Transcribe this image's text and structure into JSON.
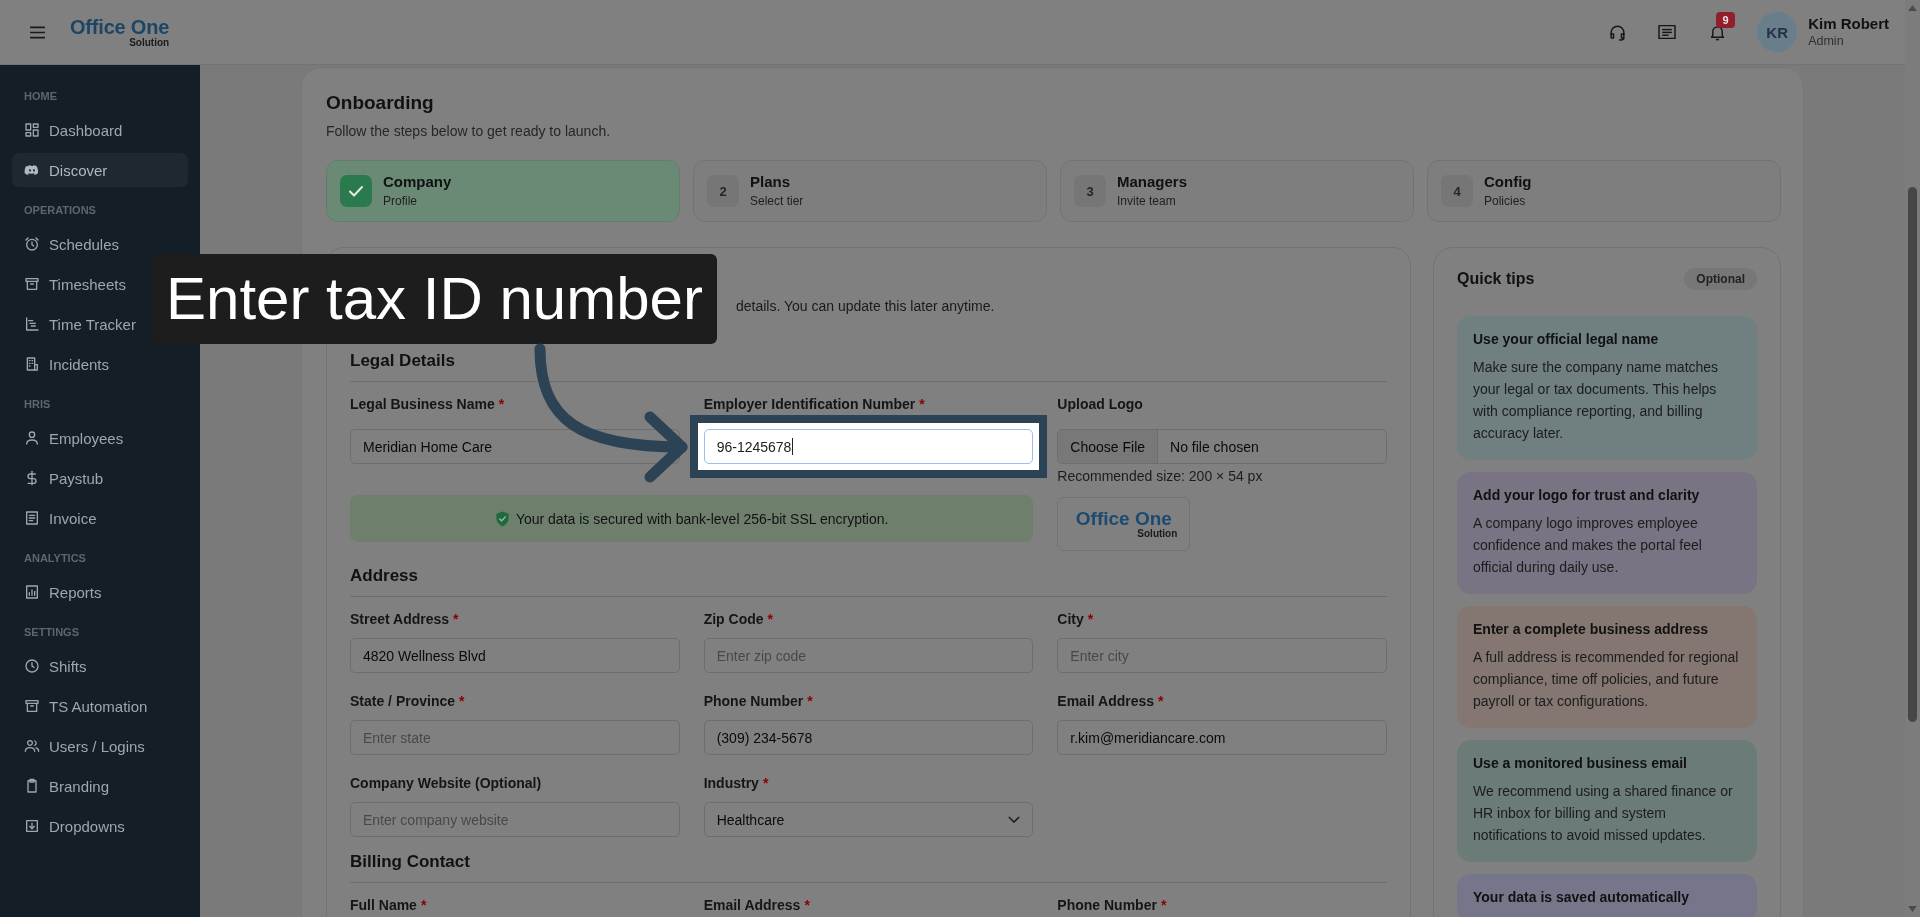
{
  "header": {
    "logo": {
      "name": "Office One",
      "tagline": "Solution"
    },
    "notification_count": "9",
    "user": {
      "initials": "KR",
      "name": "Kim Robert",
      "role": "Admin"
    }
  },
  "sidebar": {
    "sections": [
      {
        "heading": "HOME",
        "items": [
          {
            "label": "Dashboard",
            "selected": false
          },
          {
            "label": "Discover",
            "selected": true
          }
        ]
      },
      {
        "heading": "OPERATIONS",
        "items": [
          {
            "label": "Schedules",
            "selected": false
          },
          {
            "label": "Timesheets",
            "selected": false
          },
          {
            "label": "Time Tracker",
            "selected": false
          },
          {
            "label": "Incidents",
            "selected": false
          }
        ]
      },
      {
        "heading": "HRIS",
        "items": [
          {
            "label": "Employees",
            "selected": false
          },
          {
            "label": "Paystub",
            "selected": false
          },
          {
            "label": "Invoice",
            "selected": false
          }
        ]
      },
      {
        "heading": "ANALYTICS",
        "items": [
          {
            "label": "Reports",
            "selected": false
          }
        ]
      },
      {
        "heading": "SETTINGS",
        "items": [
          {
            "label": "Shifts",
            "selected": false
          },
          {
            "label": "TS Automation",
            "selected": false
          },
          {
            "label": "Users / Logins",
            "selected": false
          },
          {
            "label": "Branding",
            "selected": false
          },
          {
            "label": "Dropdowns",
            "selected": false
          }
        ]
      }
    ]
  },
  "onboarding": {
    "title": "Onboarding",
    "subtitle": "Follow the steps below to get ready to launch.",
    "steps": [
      {
        "title": "Company",
        "subtitle": "Profile",
        "completed": true
      },
      {
        "number": "2",
        "title": "Plans",
        "subtitle": "Select tier",
        "completed": false
      },
      {
        "number": "3",
        "title": "Managers",
        "subtitle": "Invite team",
        "completed": false
      },
      {
        "number": "4",
        "title": "Config",
        "subtitle": "Policies",
        "completed": false
      }
    ]
  },
  "form": {
    "intro": "details. You can update this later anytime.",
    "sections": [
      {
        "title": "Legal Details",
        "fields": [
          {
            "label": "Legal Business Name",
            "mark": "*",
            "kind": "text",
            "value": "Meridian Home Care"
          },
          {
            "label": "Employer Identification Number",
            "mark": "*",
            "kind": "text",
            "value": "96-1245678",
            "spotlight": true,
            "focused": true
          },
          {
            "label": "Upload Logo",
            "kind": "file",
            "button": "Choose File",
            "status": "No file chosen",
            "hint": "Recommended size: 200 × 54 px",
            "preview": {
              "name": "Office One",
              "tagline": "Solution"
            }
          }
        ],
        "notice": "Your data is secured with bank-level 256-bit SSL encryption."
      },
      {
        "title": "Address",
        "fields": [
          {
            "label": "Street Address",
            "mark": "*",
            "kind": "text",
            "value": "4820 Wellness Blvd"
          },
          {
            "label": "Zip Code",
            "mark": "*",
            "kind": "text",
            "placeholder": "Enter zip code"
          },
          {
            "label": "City",
            "mark": "*",
            "kind": "text",
            "placeholder": "Enter city"
          },
          {
            "label": "State / Province",
            "mark": "*",
            "kind": "text",
            "placeholder": "Enter state"
          },
          {
            "label": "Phone Number",
            "mark": "*",
            "kind": "text",
            "value": "(309) 234-5678"
          },
          {
            "label": "Email Address",
            "mark": "*",
            "kind": "text",
            "value": "r.kim@meridiancare.com"
          },
          {
            "label": "Company Website (Optional)",
            "kind": "text",
            "placeholder": "Enter company website"
          },
          {
            "label": "Industry",
            "mark": "*",
            "kind": "select",
            "value": "Healthcare"
          }
        ]
      },
      {
        "title": "Billing Contact",
        "fields": [
          {
            "label": "Full Name",
            "mark": "*"
          },
          {
            "label": "Email Address",
            "mark": "*"
          },
          {
            "label": "Phone Number",
            "mark": "*"
          }
        ]
      }
    ]
  },
  "tips": {
    "title": "Quick tips",
    "badge": "Optional",
    "items": [
      {
        "title": "Use your official legal name",
        "body": "Make sure the company name matches your legal or tax documents. This helps with compliance reporting, and billing accuracy later.",
        "color": "#707f80"
      },
      {
        "title": "Add your logo for trust and clarity",
        "body": "A company logo improves employee confidence and makes the portal feel official during daily use.",
        "color": "#7a7383"
      },
      {
        "title": "Enter a complete business address",
        "body": "A full address is recommended for regional compliance, time off policies, and future payroll or tax configurations.",
        "color": "#847771"
      },
      {
        "title": "Use a monitored business email",
        "body": "We recommend using a shared finance or HR inbox for billing and system notifications to avoid missed updates.",
        "color": "#6b7c78"
      },
      {
        "title": "Your data is saved automatically",
        "color": "#75768a"
      }
    ]
  },
  "tutorial": {
    "callout": "Enter tax ID number"
  }
}
